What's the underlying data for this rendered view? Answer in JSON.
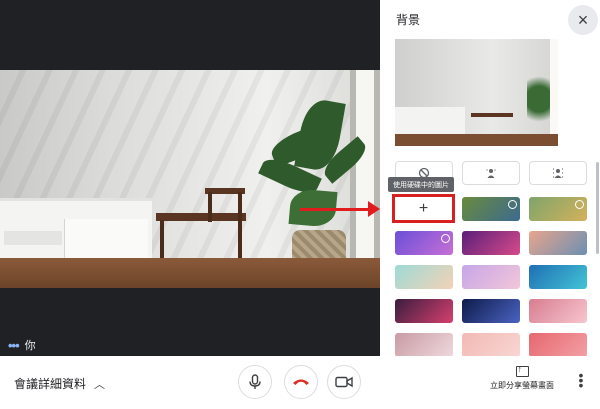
{
  "app": {
    "background_color": "#202124",
    "panel_color": "#ffffff",
    "accent_color": "#8ab4f8"
  },
  "video": {
    "self_label": "你",
    "status_icon": "audio-activity-dots-icon"
  },
  "background_panel": {
    "title": "背景",
    "close_icon": "close-icon",
    "options": [
      {
        "name": "no-effect",
        "icon": "no-effect-icon",
        "glyph": "⃠"
      },
      {
        "name": "slight-blur",
        "icon": "slight-blur-icon",
        "glyph": "⍜"
      },
      {
        "name": "blur",
        "icon": "blur-icon",
        "glyph": "⍥"
      }
    ],
    "add_image_tooltip": "使用硬碟中的圖片",
    "add_image_glyph": "+",
    "thumbnails": [
      {
        "name": "bg-forest-animated",
        "colors": [
          "#6a8b3d",
          "#3b6a8f"
        ],
        "animated": true
      },
      {
        "name": "bg-fish-tank-animated",
        "colors": [
          "#7ea56a",
          "#d4b15c"
        ],
        "animated": true
      },
      {
        "name": "bg-party-animated",
        "colors": [
          "#6a4fd8",
          "#c86fd6"
        ],
        "animated": true
      },
      {
        "name": "bg-purple-stage",
        "colors": [
          "#5b1f7a",
          "#d64a8a"
        ],
        "animated": false
      },
      {
        "name": "bg-sunset-sea",
        "colors": [
          "#e8a58c",
          "#6b8fb3"
        ],
        "animated": false
      },
      {
        "name": "bg-beach",
        "colors": [
          "#9fdad6",
          "#f2d2b6"
        ],
        "animated": false
      },
      {
        "name": "bg-pastel-sky",
        "colors": [
          "#c7a6e8",
          "#f2c6d9"
        ],
        "animated": false
      },
      {
        "name": "bg-underwater",
        "colors": [
          "#1f6fb3",
          "#43c3d6"
        ],
        "animated": false
      },
      {
        "name": "bg-pink-nebula",
        "colors": [
          "#3a1d3f",
          "#d6406e"
        ],
        "animated": false
      },
      {
        "name": "bg-galaxy",
        "colors": [
          "#0e1b4a",
          "#4a63c2"
        ],
        "animated": false
      },
      {
        "name": "bg-cherry-blossom",
        "colors": [
          "#d77d8f",
          "#f7c5cf"
        ],
        "animated": false
      },
      {
        "name": "bg-pink-confetti",
        "colors": [
          "#c99aa4",
          "#eed9dc"
        ],
        "animated": false
      },
      {
        "name": "bg-pink-dots",
        "colors": [
          "#f2b9b5",
          "#f8d6d2"
        ],
        "animated": false
      },
      {
        "name": "bg-pink-pattern",
        "colors": [
          "#e7676f",
          "#f2a0a4"
        ],
        "animated": false
      }
    ]
  },
  "bottom_bar": {
    "meeting_details": "會議詳細資料",
    "meeting_details_icon": "chevron-up-icon",
    "mic_icon": "microphone-icon",
    "hangup_icon": "hang-up-icon",
    "camera_icon": "camera-icon",
    "present_label": "立即分享螢幕畫面",
    "present_icon": "present-screen-icon",
    "more_icon": "more-vertical-icon",
    "hangup_color": "#d93025"
  },
  "annotation": {
    "color": "#e01c1c"
  }
}
